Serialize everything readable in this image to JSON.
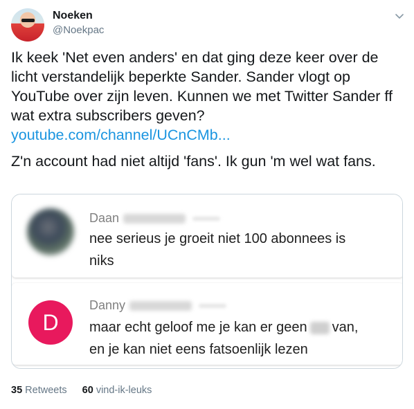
{
  "author": {
    "name": "Noeken",
    "handle": "@Noekpac",
    "menu_icon": "chevron-down-icon"
  },
  "tweet": {
    "lines": [
      "Ik keek 'Net even anders' en dat ging deze keer over de",
      "licht verstandelijk beperkte Sander. Sander vlogt op",
      "YouTube over zijn leven. Kunnen we met Twitter Sander ff",
      "wat extra subscribers geven?"
    ],
    "link": "youtube.com/channel/UCnCMb...",
    "closing": "Z'n account had niet altijd 'fans'. Ik gun 'm wel wat fans."
  },
  "comments": [
    {
      "name": "Daan",
      "lines": [
        "nee serieus je groeit niet 100 abonnees is",
        "niks"
      ]
    },
    {
      "name": "Danny",
      "initial": "D",
      "line1_before": "maar echt geloof me je kan er geen",
      "line1_after": "van,",
      "line2": "en je kan niet eens fatsoenlijk lezen"
    }
  ],
  "stats": {
    "retweets_count": "35",
    "retweets_label": "Retweets",
    "likes_count": "60",
    "likes_label": "vind-ik-leuks"
  },
  "colors": {
    "link": "#1b95e0",
    "danny_avatar": "#e8195d",
    "secondary_text": "#657786"
  }
}
